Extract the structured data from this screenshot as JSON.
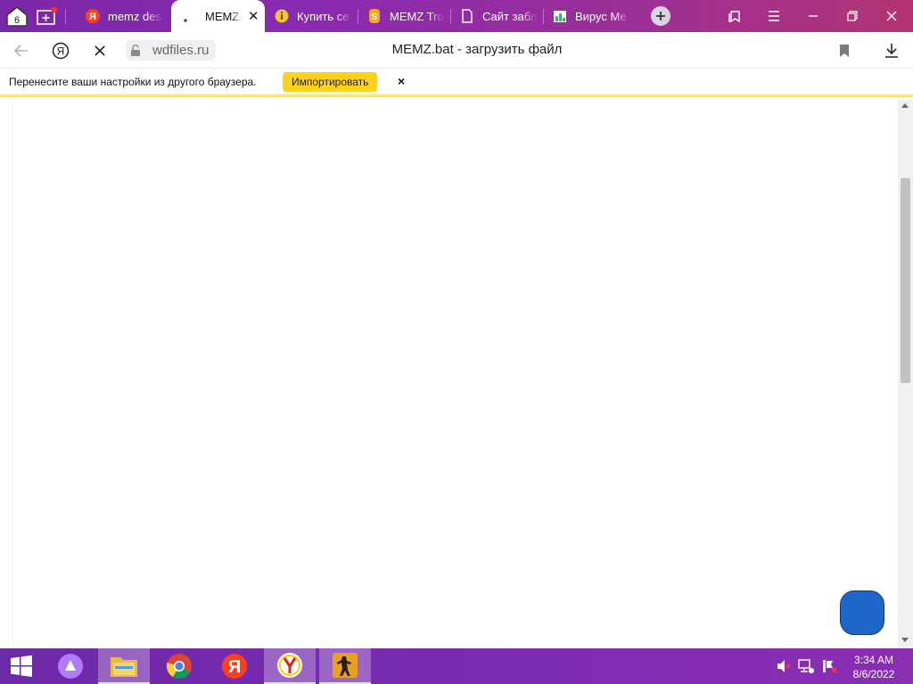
{
  "browser": {
    "tab_count_badge": "6",
    "tabs": [
      {
        "label": "memz des",
        "favicon": "yandex-icon",
        "active": false
      },
      {
        "label": "MEMZ.",
        "favicon": "loading-icon",
        "active": true
      },
      {
        "label": "Купить се",
        "favicon": "info-coin-icon",
        "active": false
      },
      {
        "label": "MEMZ Tro",
        "favicon": "orange-s-icon",
        "active": false
      },
      {
        "label": "Сайт забл",
        "favicon": "document-icon",
        "active": false
      },
      {
        "label": "Вирус Ме",
        "favicon": "green-chart-icon",
        "active": false
      }
    ],
    "address": {
      "domain": "wdfiles.ru",
      "page_title": "MEMZ.bat - загрузить файл"
    },
    "banner": {
      "text": "Перенесите ваши настройки из другого браузера.",
      "import_label": "Импортировать",
      "close_label": "×"
    }
  },
  "taskbar": {
    "apps": [
      {
        "name": "start-button"
      },
      {
        "name": "alice-assistant"
      },
      {
        "name": "file-explorer"
      },
      {
        "name": "chrome"
      },
      {
        "name": "yandex"
      },
      {
        "name": "yandex-browser",
        "active": true
      },
      {
        "name": "counter-strike",
        "active": true
      }
    ],
    "clock": {
      "time": "3:34 AM",
      "date": "8/6/2022"
    }
  },
  "colors": {
    "tabbar_start": "#7a28a8",
    "tabbar_end": "#b23473",
    "import_button": "#ffd21f",
    "banner_border": "#f6e27a",
    "chat_bubble": "#1e66c8"
  }
}
